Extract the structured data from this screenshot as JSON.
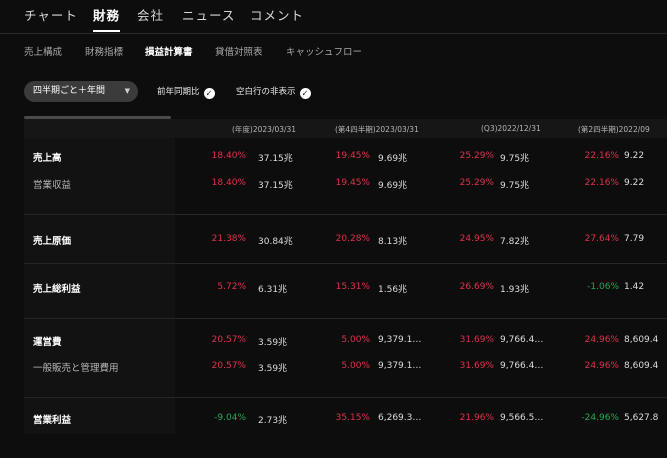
{
  "top_tabs": [
    "チャート",
    "財務",
    "会社",
    "ニュース",
    "コメント"
  ],
  "top_tab_active": 1,
  "sub_tabs": [
    "売上構成",
    "財務指標",
    "損益計算書",
    "貸借対照表",
    "キャッシュフロー"
  ],
  "sub_tab_active": 2,
  "filters": {
    "period_select": "四半期ごと＋年間",
    "yoy_toggle": "前年同期比",
    "hide_empty_toggle": "空白行の非表示"
  },
  "columns": [
    "(年度)2023/03/31",
    "(第4四半期)2023/03/31",
    "(Q3)2022/12/31",
    "(第2四半期)2022/09"
  ],
  "rows": [
    {
      "label": "売上高",
      "style": "bold",
      "cells": [
        {
          "pct": "18.40%",
          "dir": "neg",
          "val": "37.15兆"
        },
        {
          "pct": "19.45%",
          "dir": "neg",
          "val": "9.69兆"
        },
        {
          "pct": "25.29%",
          "dir": "neg",
          "val": "9.75兆"
        },
        {
          "pct": "22.16%",
          "dir": "neg",
          "val": "9.22"
        }
      ]
    },
    {
      "label": "営業収益",
      "style": "sub",
      "cells": [
        {
          "pct": "18.40%",
          "dir": "neg",
          "val": "37.15兆"
        },
        {
          "pct": "19.45%",
          "dir": "neg",
          "val": "9.69兆"
        },
        {
          "pct": "25.29%",
          "dir": "neg",
          "val": "9.75兆"
        },
        {
          "pct": "22.16%",
          "dir": "neg",
          "val": "9.22"
        }
      ]
    },
    {
      "label": "売上原価",
      "style": "bold",
      "cells": [
        {
          "pct": "21.38%",
          "dir": "neg",
          "val": "30.84兆"
        },
        {
          "pct": "20.28%",
          "dir": "neg",
          "val": "8.13兆"
        },
        {
          "pct": "24.95%",
          "dir": "neg",
          "val": "7.82兆"
        },
        {
          "pct": "27.64%",
          "dir": "neg",
          "val": "7.79"
        }
      ]
    },
    {
      "label": "売上総利益",
      "style": "bold",
      "cells": [
        {
          "pct": "5.72%",
          "dir": "neg",
          "val": "6.31兆"
        },
        {
          "pct": "15.31%",
          "dir": "neg",
          "val": "1.56兆"
        },
        {
          "pct": "26.69%",
          "dir": "neg",
          "val": "1.93兆"
        },
        {
          "pct": "-1.06%",
          "dir": "pos",
          "val": "1.42"
        }
      ]
    },
    {
      "label": "運営費",
      "style": "bold",
      "cells": [
        {
          "pct": "20.57%",
          "dir": "neg",
          "val": "3.59兆"
        },
        {
          "pct": "5.00%",
          "dir": "neg",
          "val": "9,379.1…"
        },
        {
          "pct": "31.69%",
          "dir": "neg",
          "val": "9,766.4…"
        },
        {
          "pct": "24.96%",
          "dir": "neg",
          "val": "8,609.4"
        }
      ]
    },
    {
      "label": "一般販売と管理費用",
      "style": "sub",
      "cells": [
        {
          "pct": "20.57%",
          "dir": "neg",
          "val": "3.59兆"
        },
        {
          "pct": "5.00%",
          "dir": "neg",
          "val": "9,379.1…"
        },
        {
          "pct": "31.69%",
          "dir": "neg",
          "val": "9,766.4…"
        },
        {
          "pct": "24.96%",
          "dir": "neg",
          "val": "8,609.4"
        }
      ]
    },
    {
      "label": "営業利益",
      "style": "bold",
      "cells": [
        {
          "pct": "-9.04%",
          "dir": "pos",
          "val": "2.73兆"
        },
        {
          "pct": "35.15%",
          "dir": "neg",
          "val": "6,269.3…"
        },
        {
          "pct": "21.96%",
          "dir": "neg",
          "val": "9,566.5…"
        },
        {
          "pct": "-24.96%",
          "dir": "pos",
          "val": "5,627.8"
        }
      ]
    }
  ],
  "colors": {
    "up": "#e0314b",
    "down": "#23a955",
    "background": "#0d0d0d"
  }
}
